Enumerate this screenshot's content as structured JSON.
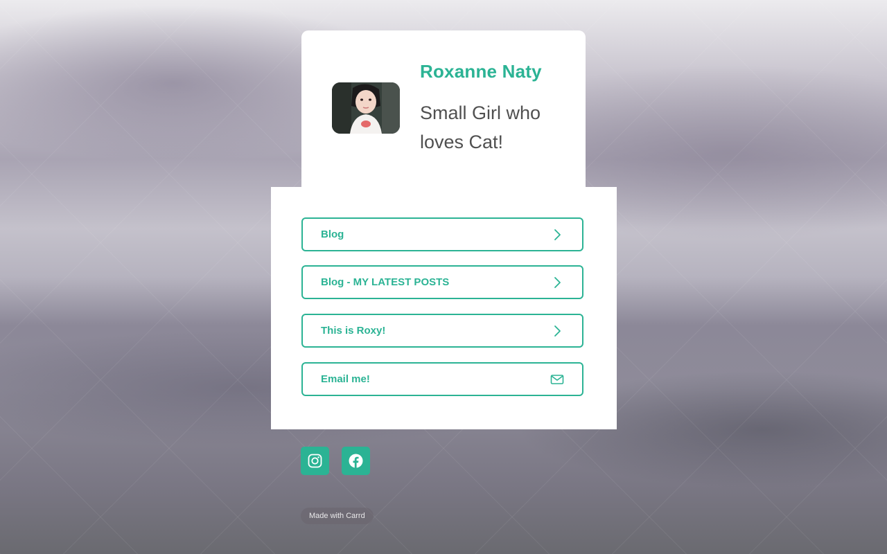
{
  "profile": {
    "name": "Roxanne Naty",
    "bio": "Small Girl who loves Cat!"
  },
  "links": [
    {
      "label": "Blog",
      "icon": "chevron-right-icon"
    },
    {
      "label": "Blog - MY LATEST POSTS",
      "icon": "chevron-right-icon"
    },
    {
      "label": "This is Roxy!",
      "icon": "chevron-right-icon"
    },
    {
      "label": "Email me!",
      "icon": "mail-icon"
    }
  ],
  "social": [
    {
      "icon": "instagram-icon"
    },
    {
      "icon": "facebook-icon"
    }
  ],
  "footer": {
    "made_with": "Made with Carrd"
  },
  "colors": {
    "accent": "#2bb394",
    "text": "#505050",
    "card": "#ffffff"
  }
}
